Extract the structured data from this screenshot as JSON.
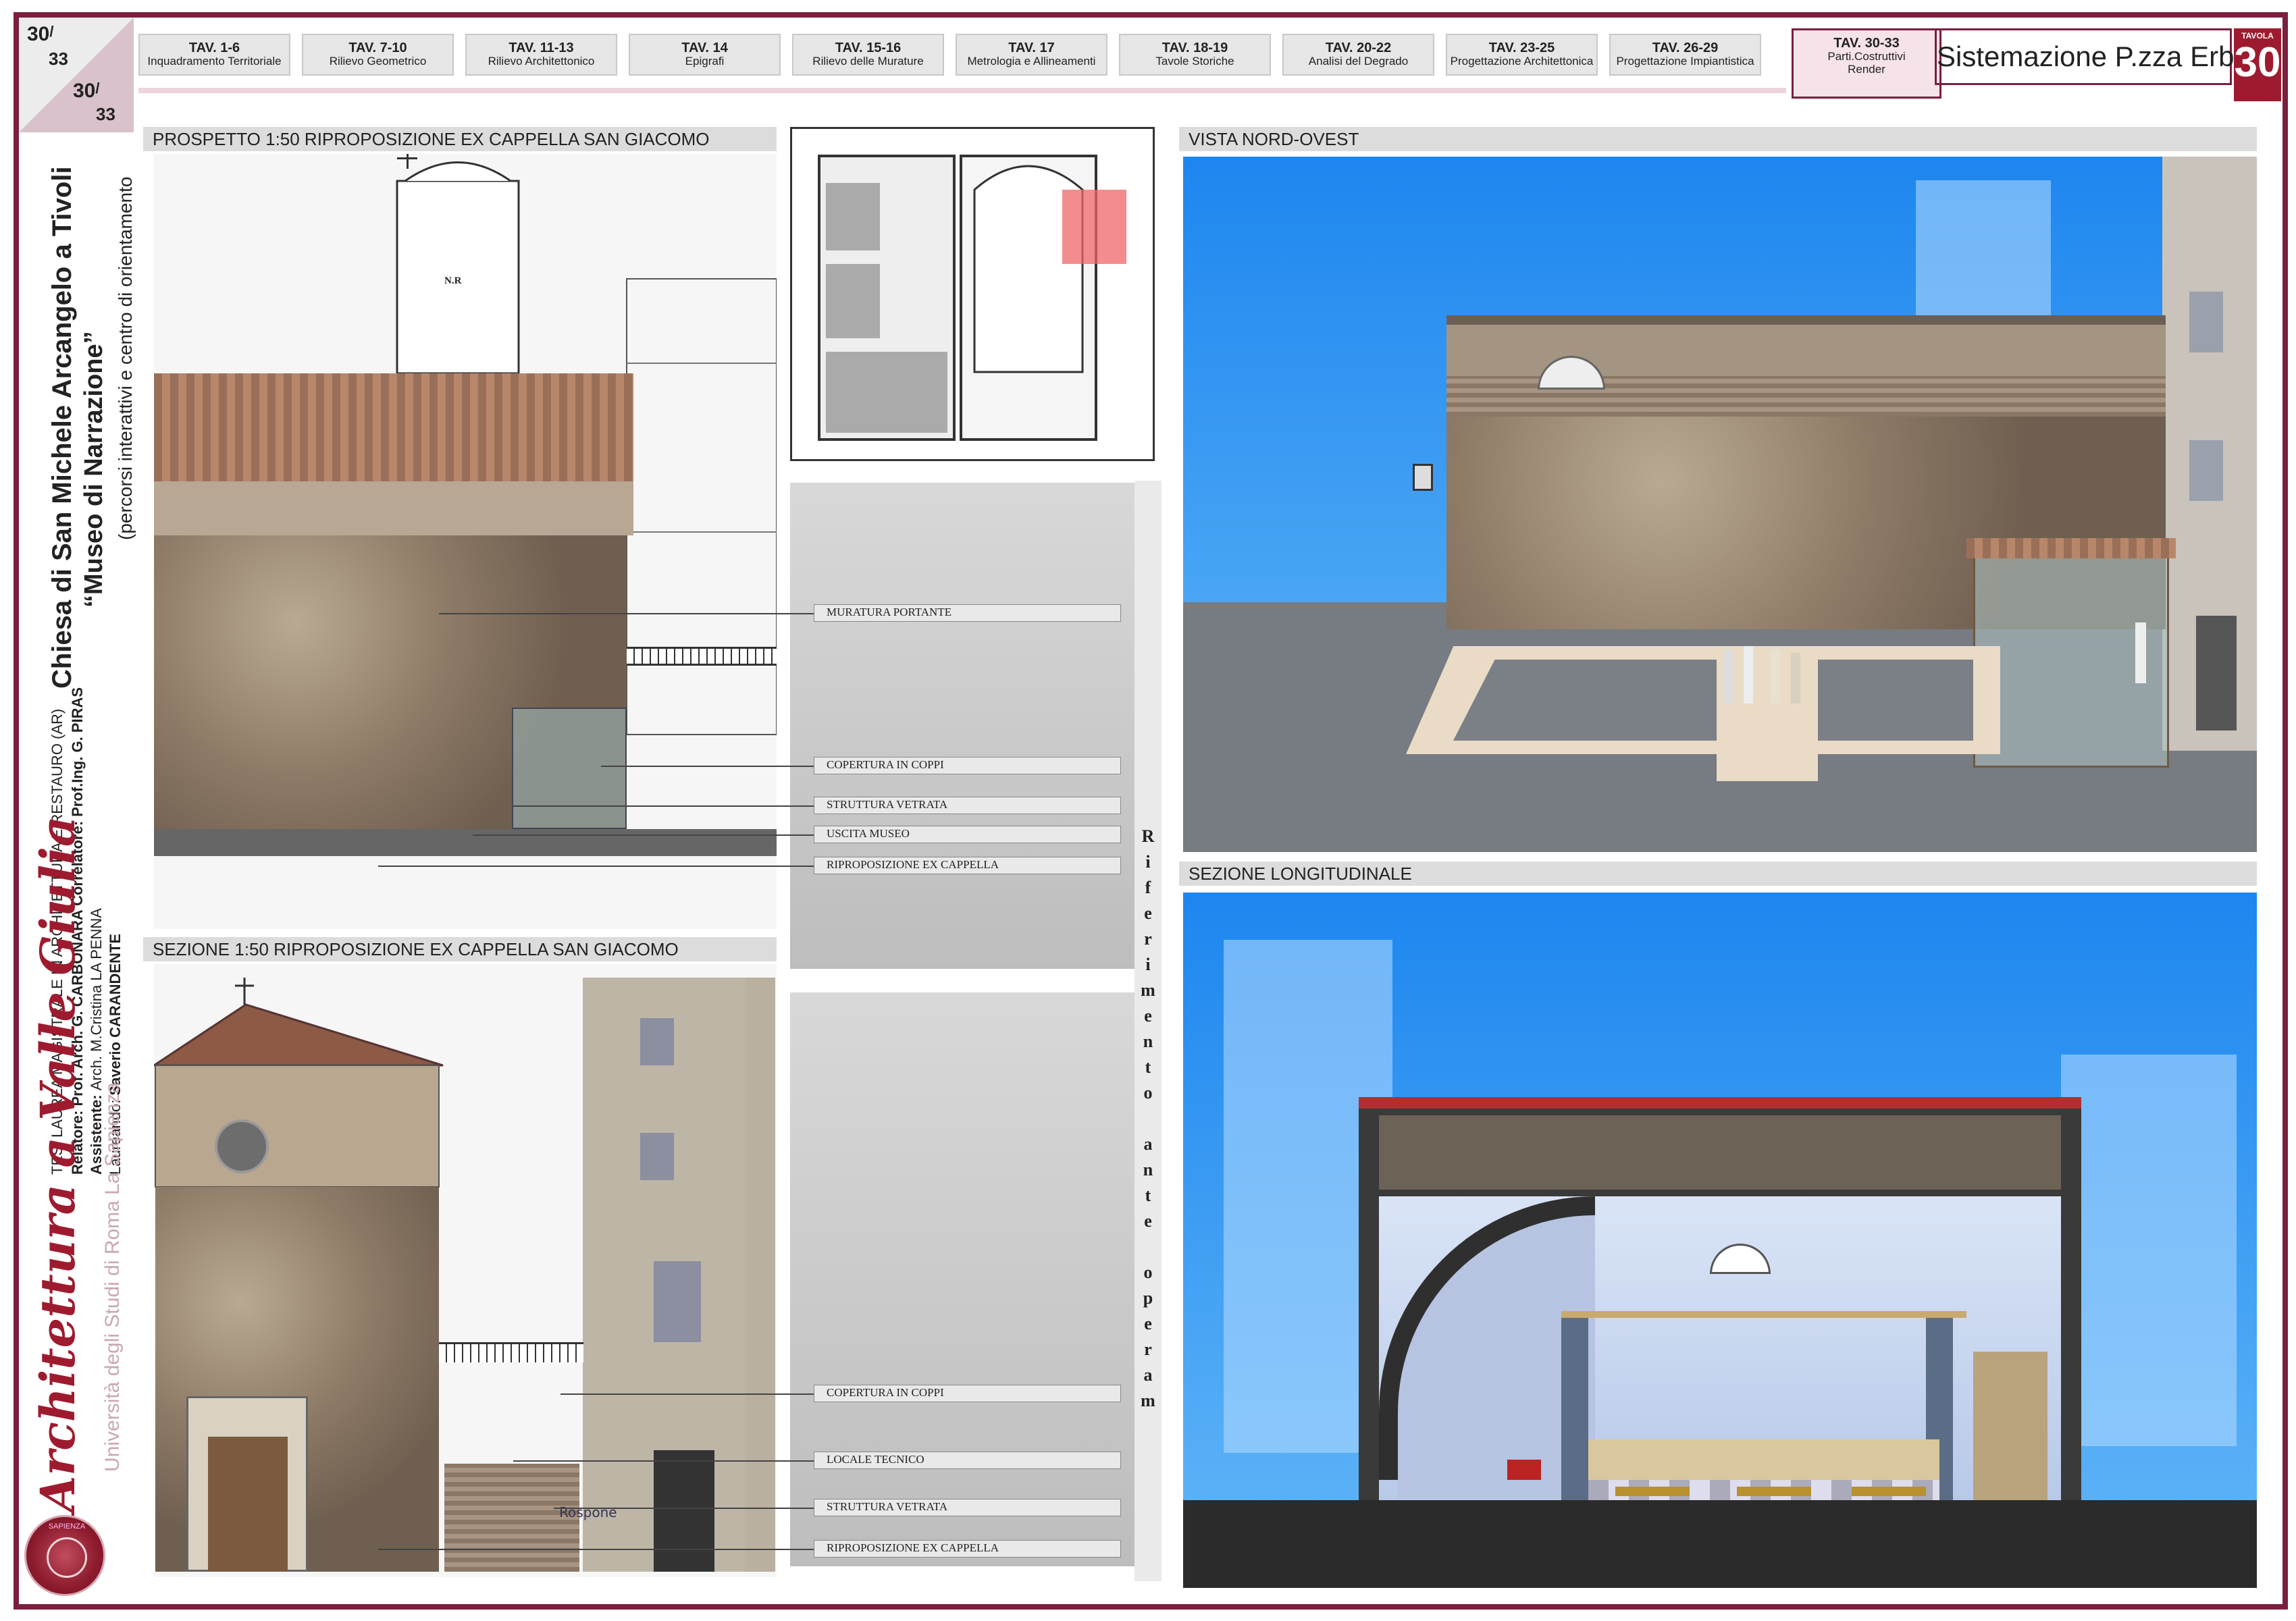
{
  "corner": {
    "top_num": "30",
    "top_den": "33",
    "bottom_num": "30",
    "bottom_den": "33"
  },
  "tabs": [
    {
      "code": "TAV. 1-6",
      "name": "Inquadramento Territoriale"
    },
    {
      "code": "TAV. 7-10",
      "name": "Rilievo Geometrico"
    },
    {
      "code": "TAV. 11-13",
      "name": "Rilievo Architettonico"
    },
    {
      "code": "TAV. 14",
      "name": "Epigrafi"
    },
    {
      "code": "TAV. 15-16",
      "name": "Rilievo delle Murature"
    },
    {
      "code": "TAV. 17",
      "name": "Metrologia e Allineamenti"
    },
    {
      "code": "TAV. 18-19",
      "name": "Tavole Storiche"
    },
    {
      "code": "TAV. 20-22",
      "name": "Analisi del Degrado"
    },
    {
      "code": "TAV. 23-25",
      "name": "Progettazione Architettonica"
    },
    {
      "code": "TAV. 26-29",
      "name": "Progettazione Impiantistica"
    },
    {
      "code": "TAV. 30-33",
      "name": "Parti.Costruttivi",
      "name2": "Render"
    }
  ],
  "header": {
    "title": "Sistemazione P.zza Erbe",
    "tavola_label": "TAVOLA",
    "tavola_num": "30"
  },
  "side": {
    "title1": "Chiesa di San Michele Arcangelo a Tivoli",
    "title2": "“Museo di Narrazione”",
    "subtitle": "(percorsi interattivi e centro di orientamento",
    "thesis": "TESI LAUREA MAGISTRALE IN ARCHITETTURA E RESTAURO (AR)",
    "relatore_label": "Relatore: ",
    "relatore": "Prof. Arch. G. CARBONARA",
    "correlatore_label": "  Correlatore: ",
    "correlatore": "Prof.Ing. G. PIRAS",
    "assistente_label": "Assistente: ",
    "assistente": "Arch. M.Cristina LA PENNA",
    "laureando_label": "Laureando: ",
    "laureando": "Saverio CARANDENTE",
    "logo": "Architettura a Valle Giulia",
    "university": "Università degli Studi di Roma La Sapienza",
    "seal": "SAPIENZA"
  },
  "sections": {
    "prospetto": "PROSPETTO 1:50 RIPROPOSIZIONE EX CAPPELLA SAN GIACOMO",
    "sezione": "SEZIONE 1:50 RIPROPOSIZIONE EX CAPPELLA SAN GIACOMO",
    "vista": "VISTA NORD-OVEST",
    "longitudinale": "SEZIONE LONGITUDINALE"
  },
  "prospetto_tower_label": "N.R",
  "labels_top": [
    "MURATURA PORTANTE",
    "COPERTURA IN COPPI",
    "STRUTTURA VETRATA",
    "USCITA MUSEO",
    "RIPROPOSIZIONE EX CAPPELLA"
  ],
  "labels_bottom": [
    "COPERTURA IN COPPI",
    "LOCALE TECNICO",
    "STRUTTURA VETRATA",
    "RIPROPOSIZIONE EX CAPPELLA"
  ],
  "vertical_ref": [
    "R",
    "i",
    "f",
    "e",
    "r",
    "i",
    "m",
    "e",
    "n",
    "t",
    "o",
    "",
    "a",
    "n",
    "t",
    "e",
    "",
    "o",
    "p",
    "e",
    "r",
    "a",
    "m"
  ],
  "graffiti": "Rospone",
  "colors": {
    "accent": "#7a1f3d",
    "tav_red": "#9e1b2f",
    "sky": "#1d86ef"
  }
}
